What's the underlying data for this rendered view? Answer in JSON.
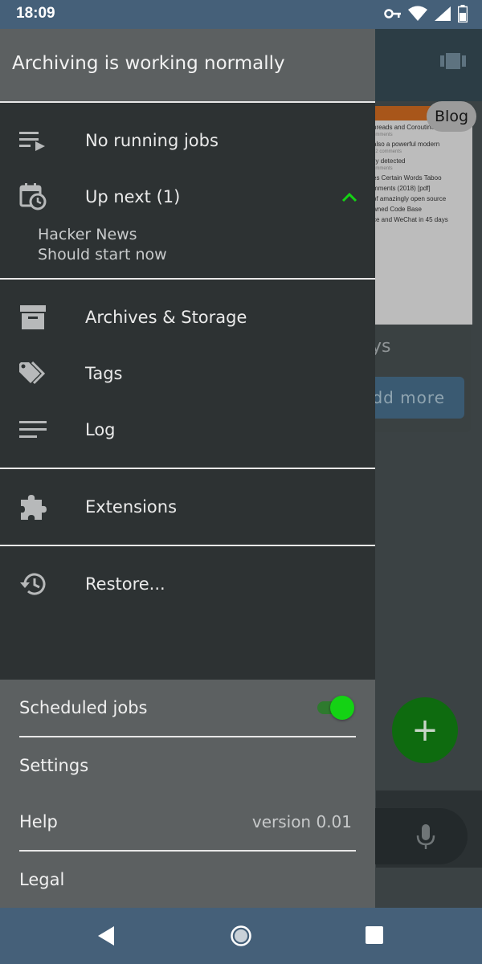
{
  "status_bar": {
    "time": "18:09"
  },
  "background": {
    "blog_chip": "Blog",
    "partial_heading": "ys",
    "add_more_button": "dd more",
    "fab_label": "+",
    "preview_lines": [
      "hreads and Coroutines",
      "omments",
      "also a powerful modern",
      "92 comments",
      "lly detected",
      "omments",
      "es Certain Words Taboo",
      "mments (2018) [pdf]",
      "of amazingly open source",
      "wned Code Base",
      "ce and WeChat in 45 days"
    ]
  },
  "drawer": {
    "header_title": "Archiving is working normally",
    "items": [
      {
        "label": "No running jobs",
        "icon": "playlist-play-icon"
      },
      {
        "label": "Up next (1)",
        "icon": "calendar-clock-icon"
      }
    ],
    "up_next_entry": {
      "title": "Hacker News",
      "subtitle": "Should start now"
    },
    "section2": [
      {
        "label": "Archives & Storage",
        "icon": "archive-icon"
      },
      {
        "label": "Tags",
        "icon": "tags-icon"
      },
      {
        "label": "Log",
        "icon": "log-lines-icon"
      }
    ],
    "section3": [
      {
        "label": "Extensions",
        "icon": "puzzle-icon"
      }
    ],
    "section4": [
      {
        "label": "Restore...",
        "icon": "restore-icon"
      }
    ],
    "bottom": {
      "scheduled_jobs": "Scheduled jobs",
      "scheduled_enabled": true,
      "settings": "Settings",
      "help": "Help",
      "version": "version 0.01",
      "legal": "Legal"
    }
  },
  "colors": {
    "accent_green": "#14d214",
    "drawer_bg": "#2d3233",
    "header_bg": "#5c6061",
    "system_bar": "#456079"
  }
}
